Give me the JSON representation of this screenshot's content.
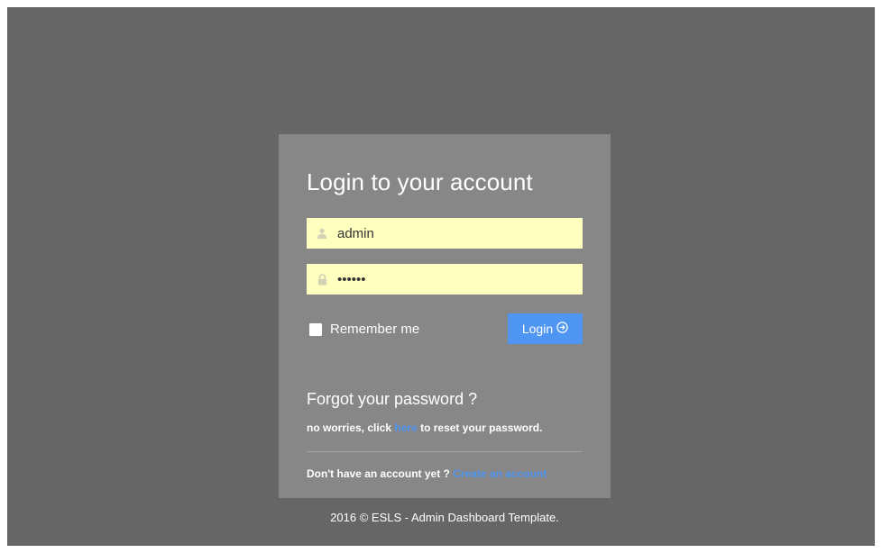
{
  "login": {
    "title": "Login to your account",
    "username_value": "admin",
    "password_value": "••••••",
    "remember_label": "Remember me",
    "login_button_label": "Login",
    "forgot_title": "Forgot your password ?",
    "forgot_prefix": "no worries, click ",
    "forgot_link": "here",
    "forgot_suffix": " to reset your password.",
    "signup_prefix": "Don't have an account yet ? ",
    "signup_link": "Create an account"
  },
  "footer": {
    "text": "2016 © ESLS - Admin Dashboard Template."
  },
  "icons": {
    "username": "user-icon",
    "password": "lock-icon",
    "login_button": "arrow-circle-right-icon"
  },
  "colors": {
    "backdrop": "#666666",
    "panel": "#878787",
    "input_bg": "#ffffc0",
    "accent": "#4f95f2"
  }
}
